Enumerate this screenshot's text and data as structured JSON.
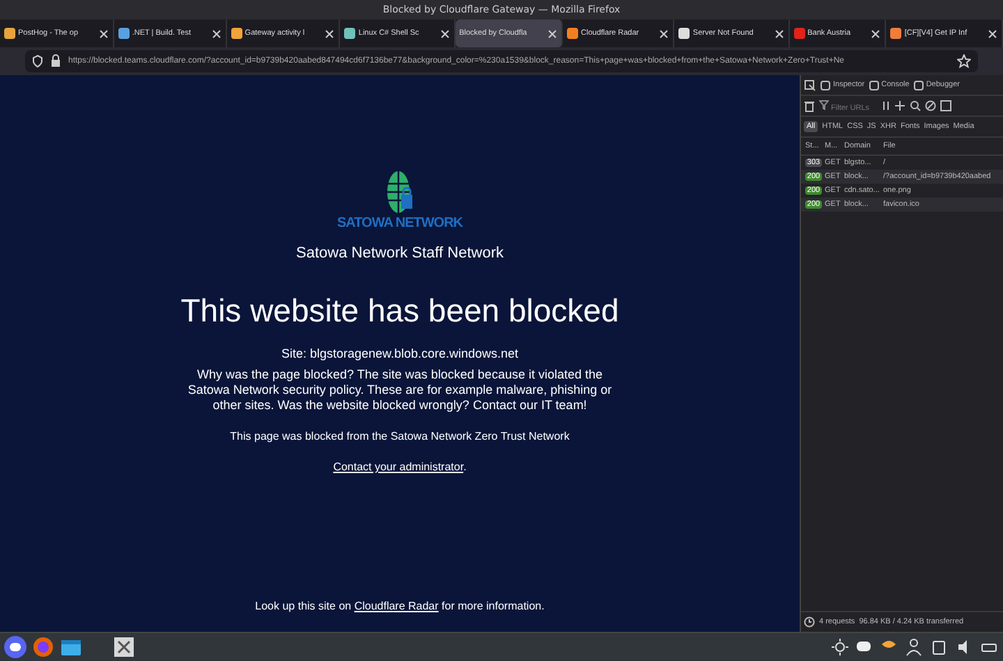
{
  "window": {
    "title": "Blocked by Cloudflare Gateway — Mozilla Firefox"
  },
  "tabs": [
    {
      "label": "PostHog - The op",
      "selected": false
    },
    {
      "label": ".NET | Build. Test",
      "selected": false
    },
    {
      "label": "Gateway activity l",
      "selected": false
    },
    {
      "label": "Linux C# Shell Sc",
      "selected": false
    },
    {
      "label": "Blocked by Cloudfla",
      "selected": true
    },
    {
      "label": "Cloudflare Radar",
      "selected": false
    },
    {
      "label": "Server Not Found",
      "selected": false
    },
    {
      "label": "Bank Austria",
      "selected": false
    },
    {
      "label": "[CF][V4] Get IP Inf",
      "selected": false
    }
  ],
  "url": "https://blocked.teams.cloudflare.com/?account_id=b9739b420aabed847494cd6f7136be77&background_color=%230a1539&block_reason=This+page+was+blocked+from+the+Satowa+Network+Zero+Trust+Ne",
  "page": {
    "logo_text": "SATOWA NETWORK",
    "network_name": "Satowa Network Staff Network",
    "heading": "This website has been blocked",
    "site": "Site: blgstoragenew.blob.core.windows.net",
    "reason": "Why was the page blocked? The site was blocked because it violated the Satowa Network security policy. These are for example malware, phishing or other sites. Was the website blocked wrongly? Contact our IT team!",
    "blocked_from": "This page was blocked from the Satowa Network Zero Trust Network",
    "contact_link": "Contact your administrator",
    "contact_end": ".",
    "lookup_before": "Look up this site on ",
    "lookup_link": "Cloudflare Radar",
    "lookup_after": " for more information."
  },
  "devtools": {
    "tools": [
      {
        "label": "Inspector",
        "selected": false
      },
      {
        "label": "Console",
        "selected": false
      },
      {
        "label": "Debugger",
        "selected": false
      }
    ],
    "filter": {
      "placeholder": "Filter URLs"
    },
    "types": [
      {
        "label": "All",
        "selected": true
      },
      {
        "label": "HTML",
        "selected": false
      },
      {
        "label": "CSS",
        "selected": false
      },
      {
        "label": "JS",
        "selected": false
      },
      {
        "label": "XHR",
        "selected": false
      },
      {
        "label": "Fonts",
        "selected": false
      },
      {
        "label": "Images",
        "selected": false
      },
      {
        "label": "Media",
        "selected": false
      }
    ],
    "columns": [
      "St...",
      "M...",
      "Domain",
      "File"
    ],
    "requests": [
      {
        "status": "303",
        "method": "GET",
        "domain": "blgsto...",
        "file": "/",
        "kind": "redirect",
        "selected": false
      },
      {
        "status": "200",
        "method": "GET",
        "domain": "block...",
        "file": "/?account_id=b9739b420aabed",
        "kind": "ok",
        "selected": true
      },
      {
        "status": "200",
        "method": "GET",
        "domain": "cdn.sato...",
        "file": "one.png",
        "kind": "ok",
        "selected": false
      },
      {
        "status": "200",
        "method": "GET",
        "domain": "block...",
        "file": "favicon.ico",
        "kind": "ok",
        "selected": true
      }
    ],
    "summary": [
      {
        "text": "4 requests"
      },
      {
        "text": "96.84 KB / 4.24 KB transferred"
      }
    ]
  }
}
